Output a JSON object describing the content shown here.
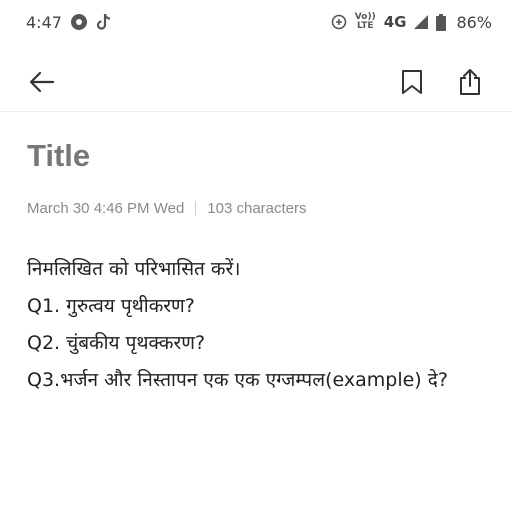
{
  "status_bar": {
    "time": "4:47",
    "network_badge_top": "Vo))",
    "network_badge_bottom": "LTE",
    "network_type": "4G",
    "battery_percent": "86%"
  },
  "note": {
    "title": "Title",
    "date": "March 30 4:46 PM Wed",
    "char_count": "103 characters",
    "lines": [
      "निमलिखित को परिभासित करें।",
      "Q1. गुरुत्वय पृथीकरण?",
      "Q2. चुंबकीय पृथक्करण?",
      "Q3.भर्जन और निस्तापन एक एक एग्जम्पल(example) दे?"
    ]
  },
  "icons": {
    "back": "arrow-left-icon",
    "bookmark": "bookmark-icon",
    "share": "share-icon"
  }
}
